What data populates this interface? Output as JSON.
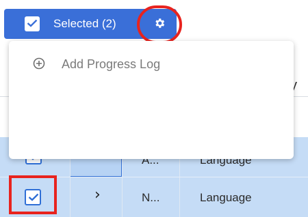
{
  "toolbar": {
    "selected_label": "Selected (2)",
    "settings_icon": "gear-icon",
    "check_icon": "check-icon"
  },
  "menu": {
    "items": [
      {
        "label": "Add Progress Log",
        "icon": "plus-circle-icon"
      }
    ]
  },
  "table": {
    "header_fragment": "y",
    "rows": [
      {
        "checked": true,
        "expand_icon": "chevron-right-icon",
        "name": "A...",
        "type": "Language"
      },
      {
        "checked": true,
        "expand_icon": "chevron-right-icon",
        "name": "N...",
        "type": "Language"
      }
    ]
  },
  "colors": {
    "accent": "#3a6fd8",
    "row_selected": "#c5dcf6",
    "annotation": "#e8231e"
  }
}
